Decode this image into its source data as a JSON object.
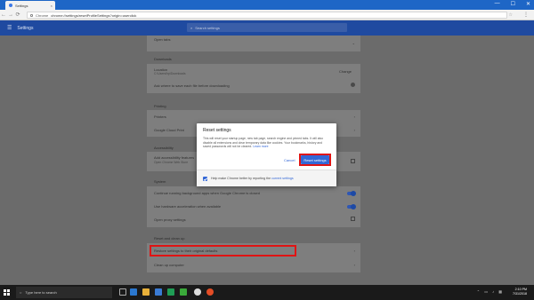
{
  "tab": {
    "title": "Settings",
    "close": "×"
  },
  "window_controls": {
    "minimize": "—",
    "maximize": "☐",
    "close": "✕"
  },
  "toolbar": {
    "back": "←",
    "forward": "→",
    "reload": "⟳",
    "scheme": "Chrome",
    "url": "chrome://settings/resetProfileSettings?origin=userclick",
    "menu": "⋮"
  },
  "header": {
    "title": "Settings",
    "search_placeholder": "Search settings"
  },
  "content": {
    "open_tabs_label": "Open tabs",
    "downloads_heading": "Downloads",
    "location_label": "Location",
    "location_path": "C:\\Users\\hp\\Downloads",
    "change_button": "Change",
    "ask_where_label": "Ask where to save each file before downloading",
    "printing_heading": "Printing",
    "printers_label": "Printers",
    "gcp_label": "Google Cloud Print",
    "accessibility_heading": "Accessibility",
    "add_features_label": "Add accessibility features",
    "open_cws_label": "Open Chrome Web Store",
    "system_heading": "System",
    "continue_bg_label": "Continue running background apps when Google Chrome is closed",
    "hw_accel_label": "Use hardware acceleration when available",
    "proxy_label": "Open proxy settings",
    "reset_heading": "Reset and clean up",
    "restore_label": "Restore settings to their original defaults",
    "cleanup_label": "Clean up computer"
  },
  "dialog": {
    "title": "Reset settings",
    "body": "This will reset your startup page, new tab page, search engine and pinned tabs. It will also disable all extensions and clear temporary data like cookies. Your bookmarks, history and saved passwords will not be cleared.",
    "learn_more": "Learn more",
    "cancel": "Cancel",
    "reset": "Reset settings",
    "footer_text": "Help make Chrome better by reporting the",
    "footer_link": "current settings"
  },
  "taskbar": {
    "search_placeholder": "Type here to search",
    "time": "2:10 PM",
    "date": "7/31/2018"
  }
}
